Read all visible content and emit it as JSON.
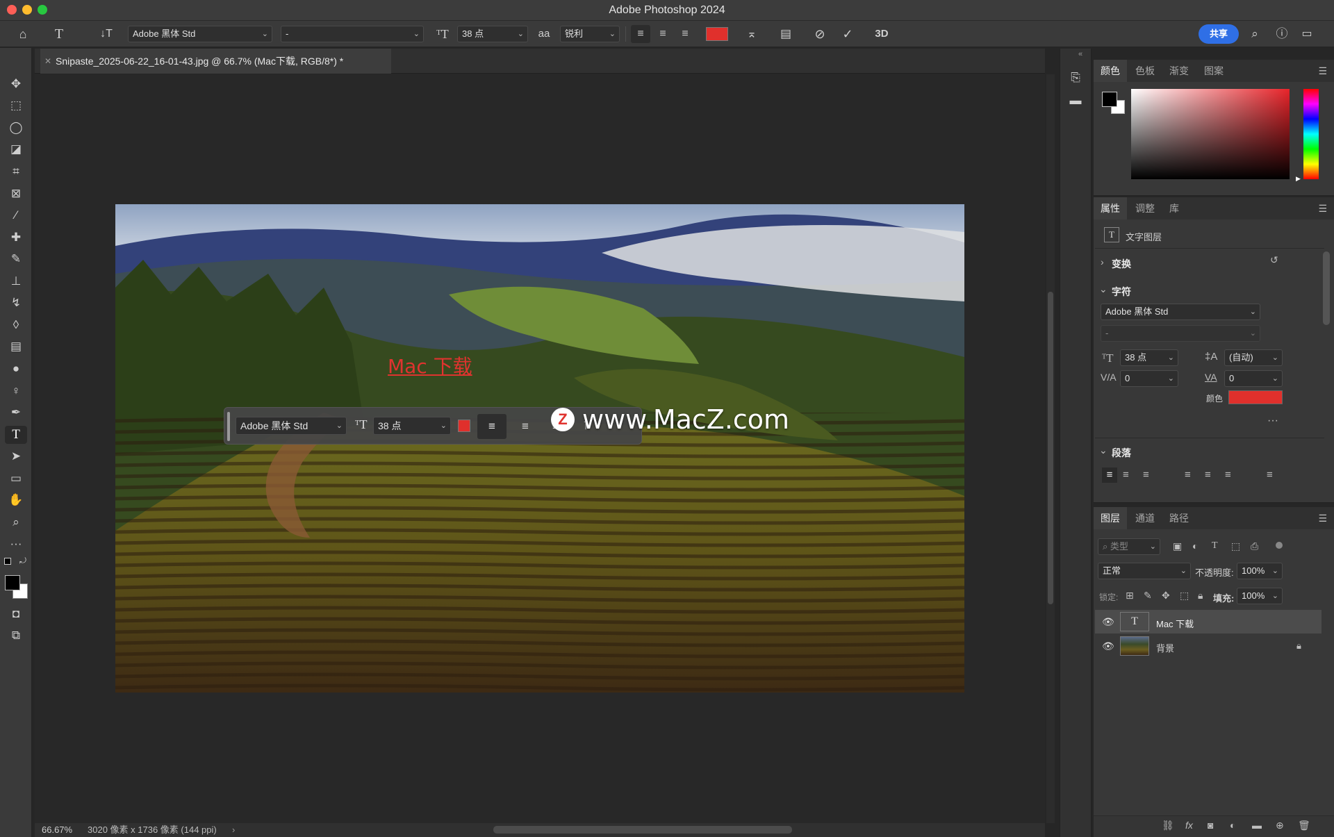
{
  "window": {
    "title": "Adobe Photoshop 2024",
    "traffic_colors": [
      "#fe5f57",
      "#febc2e",
      "#28c840"
    ]
  },
  "options_bar": {
    "font_family": "Adobe 黑体 Std",
    "font_style": "-",
    "font_size": "38 点",
    "antialias_glyph": "aa",
    "antialias": "锐利",
    "text_color": "#e0302c",
    "threed_label": "3D",
    "share_label": "共享"
  },
  "document": {
    "tab_title": "Snipaste_2025-06-22_16-01-43.jpg @ 66.7% (Mac下载, RGB/8*) *",
    "canvas_text": "Mac 下载",
    "watermark_text": "www.MacZ.com",
    "watermark_logo": "Z"
  },
  "floating_bar": {
    "font_family": "Adobe 黑体 Std",
    "font_size": "38 点",
    "text_color": "#e0302c"
  },
  "status": {
    "zoom": "66.67%",
    "info": "3020 像素 x 1736 像素 (144 ppi)"
  },
  "color_panel": {
    "tabs": [
      "颜色",
      "色板",
      "渐变",
      "图案"
    ],
    "foreground": "#000000",
    "background": "#ffffff",
    "hue": "#e8242a"
  },
  "properties_panel": {
    "tabs": [
      "属性",
      "调整",
      "库"
    ],
    "layer_kind": "文字图层",
    "transform_label": "变换",
    "character_label": "字符",
    "font_family": "Adobe 黑体 Std",
    "font_style": "-",
    "font_size": "38 点",
    "leading": "(自动)",
    "kerning": "0",
    "tracking": "0",
    "color_label": "颜色",
    "color": "#e0302c",
    "paragraph_label": "段落"
  },
  "layers_panel": {
    "tabs": [
      "图层",
      "通道",
      "路径"
    ],
    "filter_placeholder": "类型",
    "blend_mode": "正常",
    "opacity_label": "不透明度:",
    "opacity_value": "100%",
    "lock_label": "锁定:",
    "fill_label": "填充:",
    "fill_value": "100%",
    "layers": [
      {
        "name": "Mac 下载",
        "type": "text",
        "selected": true
      },
      {
        "name": "背景",
        "type": "image",
        "locked": true
      }
    ]
  }
}
